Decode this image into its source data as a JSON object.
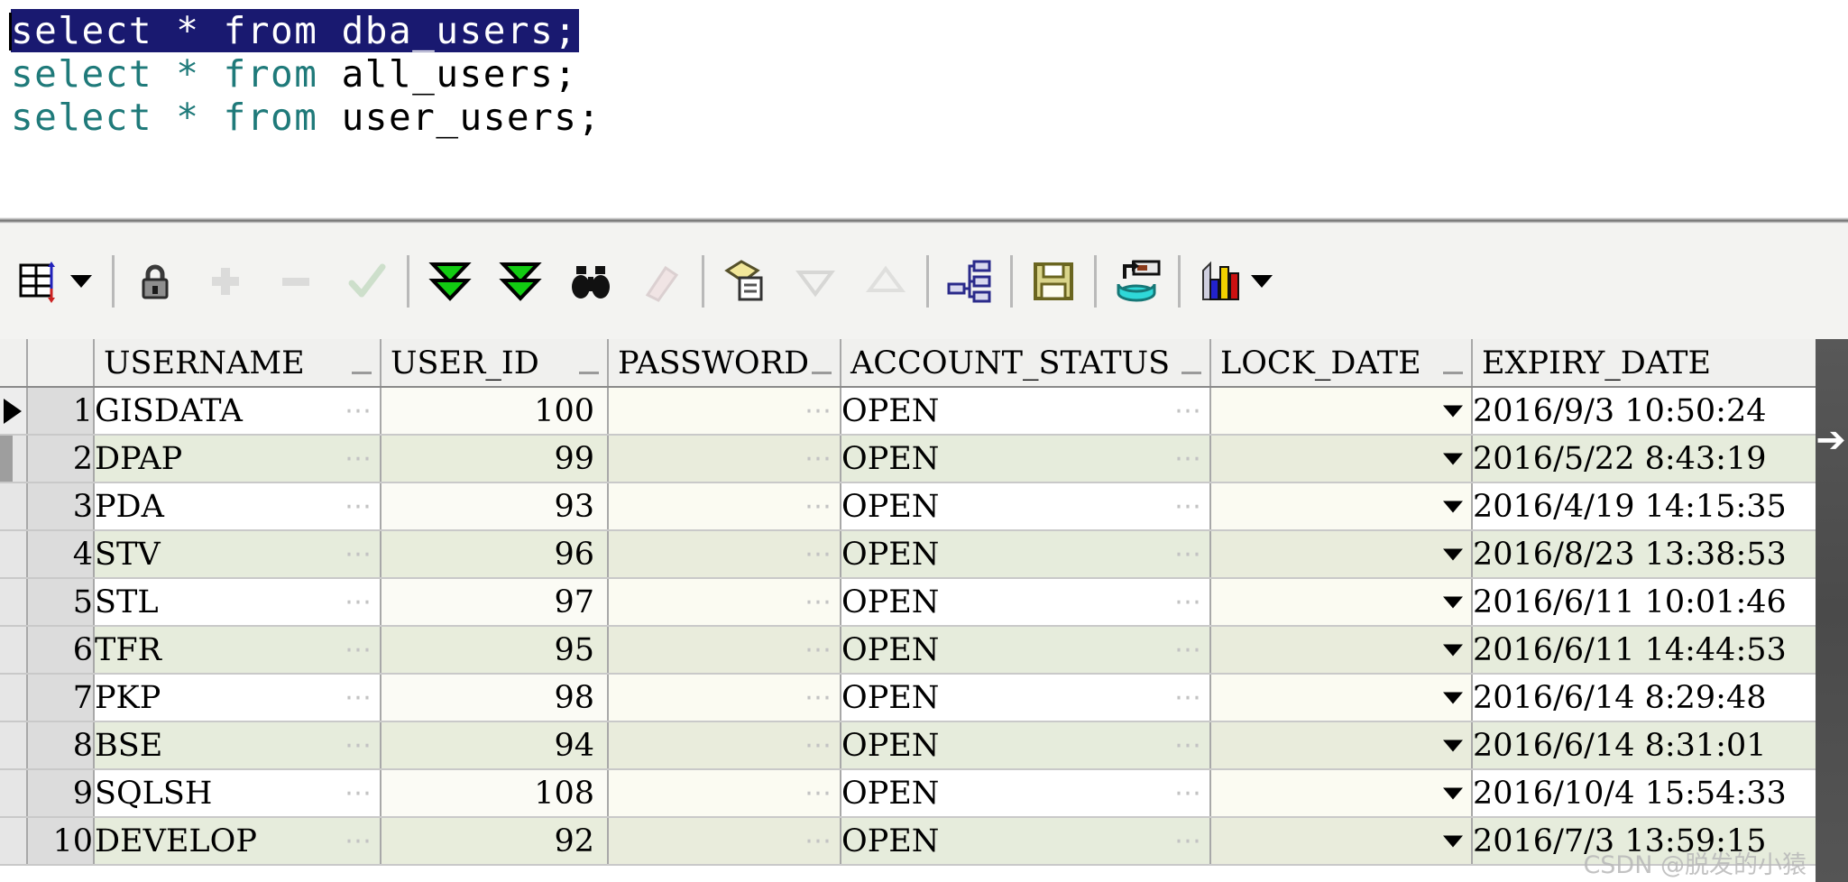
{
  "editor": {
    "lines": [
      {
        "keyword1": "select",
        "star": "*",
        "keyword2": "from",
        "table": "dba_users;",
        "selected": true
      },
      {
        "keyword1": "select",
        "star": "*",
        "keyword2": "from",
        "table": "all_users;",
        "selected": false
      },
      {
        "keyword1": "select",
        "star": "*",
        "keyword2": "from",
        "table": "user_users;",
        "selected": false
      }
    ],
    "full_text_line1": "select * from dba_users;",
    "full_text_line2": "select * from all_users;",
    "full_text_line3": "select * from user_users;",
    "selection_color": "#191970",
    "keyword_color": "#1f7a7a",
    "identifier_color": "#000000"
  },
  "toolbar": {
    "items": [
      {
        "name": "grid-layout-icon",
        "label": "Grid Layout",
        "has_caret": true,
        "disabled": false
      },
      {
        "name": "lock-icon",
        "label": "Lock Record",
        "disabled": false
      },
      {
        "name": "plus-icon",
        "label": "Insert Record",
        "disabled": true
      },
      {
        "name": "minus-icon",
        "label": "Delete Record",
        "disabled": true
      },
      {
        "name": "check-icon",
        "label": "Post Changes",
        "disabled": true
      },
      {
        "name": "fetch-next-icon",
        "label": "Fetch Next Page",
        "disabled": false
      },
      {
        "name": "fetch-all-icon",
        "label": "Fetch All",
        "disabled": false
      },
      {
        "name": "binoculars-icon",
        "label": "Find",
        "disabled": false
      },
      {
        "name": "eraser-icon",
        "label": "Clear Filter",
        "disabled": true
      },
      {
        "name": "copy-to-clipboard-icon",
        "label": "Copy to Clipboard",
        "disabled": false
      },
      {
        "name": "sort-descending-icon",
        "label": "Sort Descending",
        "disabled": true
      },
      {
        "name": "sort-ascending-icon",
        "label": "Sort Ascending",
        "disabled": true
      },
      {
        "name": "hierarchy-icon",
        "label": "Group By",
        "disabled": false
      },
      {
        "name": "save-floppy-icon",
        "label": "Export Data",
        "disabled": false
      },
      {
        "name": "database-export-icon",
        "label": "Send to Database",
        "disabled": false
      },
      {
        "name": "bar-chart-icon",
        "label": "Chart",
        "has_caret": true,
        "disabled": false
      }
    ]
  },
  "grid": {
    "columns": [
      {
        "key": "username",
        "label": "USERNAME"
      },
      {
        "key": "user_id",
        "label": "USER_ID"
      },
      {
        "key": "password",
        "label": "PASSWORD"
      },
      {
        "key": "account_status",
        "label": "ACCOUNT_STATUS"
      },
      {
        "key": "lock_date",
        "label": "LOCK_DATE"
      },
      {
        "key": "expiry_date",
        "label": "EXPIRY_DATE"
      }
    ],
    "ellipsis_glyph": "⋯",
    "rows": [
      {
        "n": "1",
        "username": "GISDATA",
        "user_id": "100",
        "password": "",
        "account_status": "OPEN",
        "lock_date": "",
        "expiry_date": "2016/9/3 10:50:24",
        "current": true
      },
      {
        "n": "2",
        "username": "DPAP",
        "user_id": "99",
        "password": "",
        "account_status": "OPEN",
        "lock_date": "",
        "expiry_date": "2016/5/22 8:43:19",
        "current": false
      },
      {
        "n": "3",
        "username": "PDA",
        "user_id": "93",
        "password": "",
        "account_status": "OPEN",
        "lock_date": "",
        "expiry_date": "2016/4/19 14:15:35",
        "current": false
      },
      {
        "n": "4",
        "username": "STV",
        "user_id": "96",
        "password": "",
        "account_status": "OPEN",
        "lock_date": "",
        "expiry_date": "2016/8/23 13:38:53",
        "current": false
      },
      {
        "n": "5",
        "username": "STL",
        "user_id": "97",
        "password": "",
        "account_status": "OPEN",
        "lock_date": "",
        "expiry_date": "2016/6/11 10:01:46",
        "current": false
      },
      {
        "n": "6",
        "username": "TFR",
        "user_id": "95",
        "password": "",
        "account_status": "OPEN",
        "lock_date": "",
        "expiry_date": "2016/6/11 14:44:53",
        "current": false
      },
      {
        "n": "7",
        "username": "PKP",
        "user_id": "98",
        "password": "",
        "account_status": "OPEN",
        "lock_date": "",
        "expiry_date": "2016/6/14 8:29:48",
        "current": false
      },
      {
        "n": "8",
        "username": "BSE",
        "user_id": "94",
        "password": "",
        "account_status": "OPEN",
        "lock_date": "",
        "expiry_date": "2016/6/14 8:31:01",
        "current": false
      },
      {
        "n": "9",
        "username": "SQLSH",
        "user_id": "108",
        "password": "",
        "account_status": "OPEN",
        "lock_date": "",
        "expiry_date": "2016/10/4 15:54:33",
        "current": false
      },
      {
        "n": "10",
        "username": "DEVELOP",
        "user_id": "92",
        "password": "",
        "account_status": "OPEN",
        "lock_date": "",
        "expiry_date": "2016/7/3 13:59:15",
        "current": false
      }
    ]
  },
  "scroll": {
    "right_arrow_glyph": "➔"
  },
  "watermark": {
    "text": "CSDN @脱发的小猿"
  }
}
